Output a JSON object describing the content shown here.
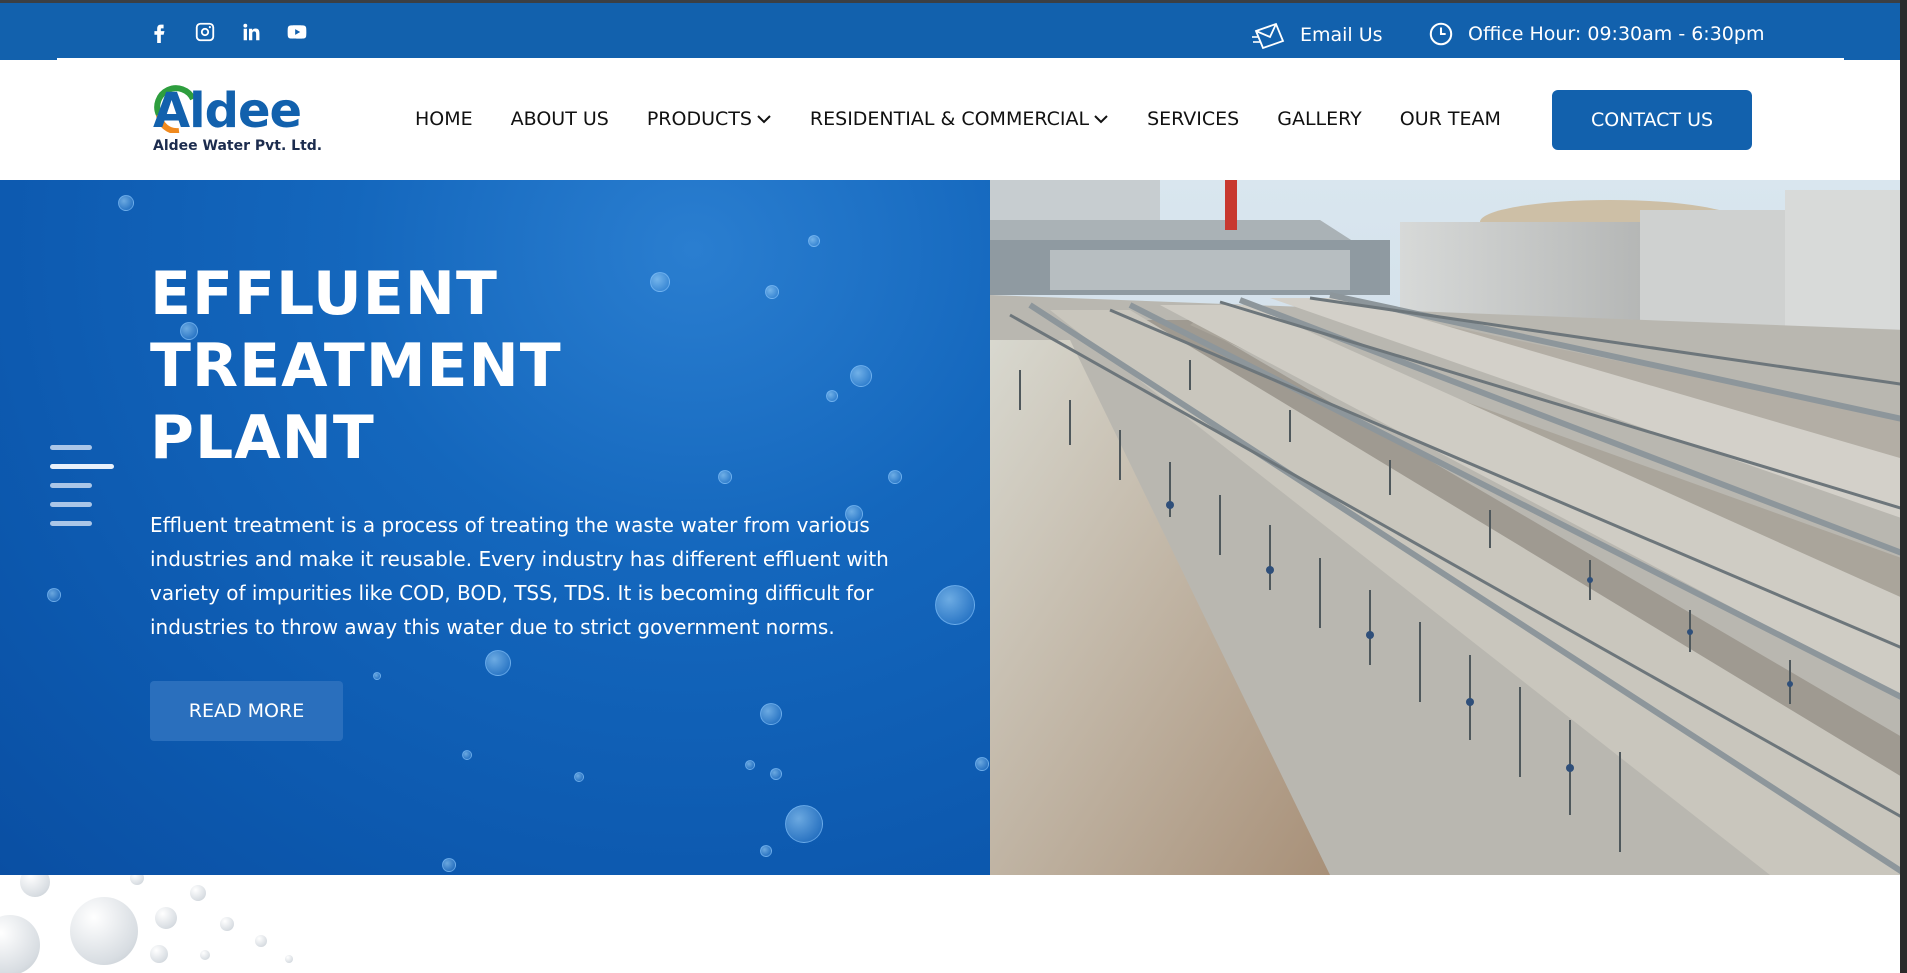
{
  "topbar": {
    "social": [
      {
        "icon": "facebook-icon"
      },
      {
        "icon": "instagram-icon"
      },
      {
        "icon": "linkedin-icon"
      },
      {
        "icon": "youtube-icon"
      }
    ],
    "email_label": "Email Us",
    "office_hours": "Office Hour: 09:30am - 6:30pm"
  },
  "header": {
    "logo_word": "Aldee",
    "logo_sub": "Aldee Water Pvt. Ltd.",
    "nav": [
      {
        "label": "HOME",
        "dropdown": false
      },
      {
        "label": "ABOUT US",
        "dropdown": false
      },
      {
        "label": "PRODUCTS",
        "dropdown": true
      },
      {
        "label": "RESIDENTIAL & COMMERCIAL",
        "dropdown": true
      },
      {
        "label": "SERVICES",
        "dropdown": false
      },
      {
        "label": "GALLERY",
        "dropdown": false
      },
      {
        "label": "OUR TEAM",
        "dropdown": false
      }
    ],
    "contact_label": "CONTACT US"
  },
  "hero": {
    "title_lines": [
      "EFFLUENT",
      "TREATMENT",
      "PLANT"
    ],
    "text_lines": [
      "Effluent treatment is a process of treating the waste water from various",
      "industries and make it reusable. Every industry has different effluent with",
      "variety of impurities like COD, BOD, TSS, TDS. It is becoming difficult for",
      "industries to throw away this water due to strict government norms."
    ],
    "button_label": "READ MORE",
    "image_icon": "effluent-treatment-plant-photo"
  },
  "colors": {
    "brand_blue": "#1261ad",
    "hero_blue": "#0d5ab0",
    "white": "#ffffff"
  }
}
